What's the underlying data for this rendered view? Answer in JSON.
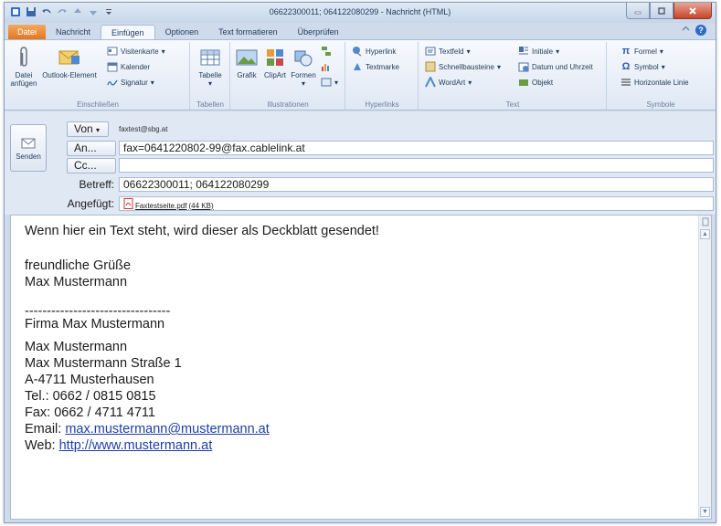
{
  "window": {
    "title": "06622300011; 064122080299 - Nachricht (HTML)"
  },
  "tabs": [
    "Datei",
    "Nachricht",
    "Einfügen",
    "Optionen",
    "Text formatieren",
    "Überprüfen"
  ],
  "active_tab": "Einfügen",
  "ribbon": {
    "einschliessen": {
      "label": "Einschließen",
      "datei_anfuegen": "Datei anfügen",
      "outlook_element": "Outlook-Element",
      "visitenkarte": "Visitenkarte",
      "kalender": "Kalender",
      "signatur": "Signatur"
    },
    "tabellen": {
      "label": "Tabellen",
      "tabelle": "Tabelle"
    },
    "illustrationen": {
      "label": "Illustrationen",
      "grafik": "Grafik",
      "clipart": "ClipArt",
      "formen": "Formen"
    },
    "hyperlinks": {
      "label": "Hyperlinks",
      "hyperlink": "Hyperlink",
      "textmarke": "Textmarke"
    },
    "text": {
      "label": "Text",
      "textfeld": "Textfeld",
      "schnellbausteine": "Schnellbausteine",
      "wordart": "WordArt",
      "initiale": "Initiale",
      "datum": "Datum und Uhrzeit",
      "objekt": "Objekt"
    },
    "symbole": {
      "label": "Symbole",
      "formel": "Formel",
      "symbol": "Symbol",
      "linie": "Horizontale Linie"
    }
  },
  "header": {
    "send_label": "Senden",
    "von_label": "Von",
    "von_value": "faxtest@sbg.at",
    "an_label": "An...",
    "an_value": "fax=0641220802-99@fax.cablelink.at",
    "cc_label": "Cc...",
    "cc_value": "",
    "betreff_label": "Betreff:",
    "betreff_value": "06622300011; 064122080299",
    "angefuegt_label": "Angefügt:",
    "attachment_name": "Faxtestseite.pdf",
    "attachment_size": "(44 KB)"
  },
  "body": {
    "line1": "Wenn hier ein Text steht, wird dieser als Deckblatt gesendet!",
    "greeting": "freundliche Grüße",
    "name": "Max Mustermann",
    "separator": "---------------------------------",
    "company": "Firma Max Mustermann",
    "addr_name": "Max Mustermann",
    "street": "Max Mustermann Straße 1",
    "city": "A-4711 Musterhausen",
    "tel": "Tel.: 0662 / 0815 0815",
    "fax": "Fax: 0662 / 4711 4711",
    "email_label": "Email: ",
    "email": "max.mustermann@mustermann.at",
    "web_label": "Web: ",
    "web": "http://www.mustermann.at"
  }
}
